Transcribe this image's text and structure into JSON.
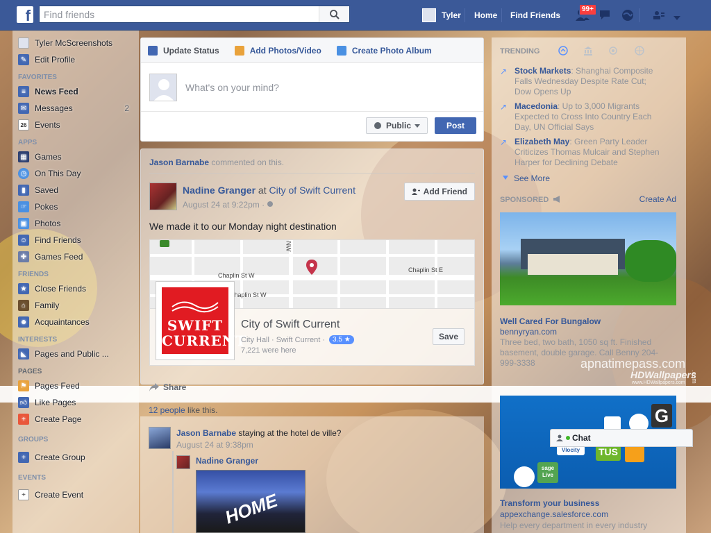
{
  "topbar": {
    "logo": "f",
    "search_placeholder": "Find friends",
    "user_name": "Tyler",
    "home": "Home",
    "find_friends": "Find Friends",
    "friend_requests_badge": "99+"
  },
  "left": {
    "profile_name": "Tyler McScreenshots",
    "edit_profile": "Edit Profile",
    "favorites_head": "Favorites",
    "news_feed": "News Feed",
    "messages": "Messages",
    "messages_count": "2",
    "events": "Events",
    "events_icon": "26",
    "apps_head": "Apps",
    "apps": [
      "Games",
      "On This Day",
      "Saved",
      "Pokes",
      "Photos",
      "Find Friends",
      "Games Feed"
    ],
    "friends_head": "Friends",
    "friends": [
      "Close Friends",
      "Family",
      "Acquaintances"
    ],
    "interests_head": "Interests",
    "interests": [
      "Pages and Public ..."
    ],
    "pages_head": "Pages",
    "pages": [
      "Pages Feed",
      "Like Pages",
      "Create Page"
    ],
    "groups_head": "Groups",
    "create_group": "Create Group",
    "events_head": "Events",
    "create_event": "Create Event"
  },
  "composer": {
    "tab_status": "Update Status",
    "tab_photos": "Add Photos/Video",
    "tab_album": "Create Photo Album",
    "placeholder": "What's on your mind?",
    "privacy": "Public",
    "post": "Post"
  },
  "story": {
    "context_actor": "Jason Barnabe",
    "context_text": "commented on this.",
    "author": "Nadine Granger",
    "at": "at",
    "place": "City of Swift Current",
    "time": "August 24 at 9:22pm · ",
    "add_friend": "Add Friend",
    "text": "We made it to our Monday night destination",
    "map_labels": [
      "Chaplin St W",
      "Chaplin St W",
      "Chaplin St E",
      "NW"
    ],
    "place_logo_line1": "SWIFT",
    "place_logo_line2": "CURRENT",
    "place_name": "City of Swift Current",
    "place_meta": "City Hall · Swift Current · ",
    "place_rating": "3.5 ★",
    "place_visits": "7,221 were here",
    "save": "Save",
    "share": "Share",
    "likes_people": "12 people",
    "likes_text": " like this."
  },
  "comments": {
    "c1_name": "Jason Barnabe",
    "c1_text": " staying at the hotel de ville?",
    "c1_time": "August 24 at 9:38pm",
    "c2_name": "Nadine Granger",
    "photo_text": "HOME"
  },
  "right": {
    "trending_head": "Trending",
    "trends": [
      {
        "topic": "Stock Markets",
        "text": ": Shanghai Composite Falls Wednesday Despite Rate Cut; Dow Opens Up"
      },
      {
        "topic": "Macedonia",
        "text": ": Up to 3,000 Migrants Expected to Cross Into Country Each Day, UN Official Says"
      },
      {
        "topic": "Elizabeth May",
        "text": ": Green Party Leader Criticizes Thomas Mulcair and Stephen Harper for Declining Debate"
      }
    ],
    "see_more": "See More",
    "sponsored_head": "Sponsored",
    "create_ad": "Create Ad",
    "ad1_title": "Well Cared For Bungalow",
    "ad1_url": "bennyryan.com",
    "ad1_desc": "Three bed, two bath, 1050 sq ft. Finished basement, double garage. Call Benny 204-999-3338",
    "ad2_title": "Transform your business",
    "ad2_url": "appexchange.salesforce.com",
    "ad2_desc": "Help every department in every industry",
    "ad2_tiles": [
      "G",
      "TUS",
      "sage Live",
      "Vlocity"
    ]
  },
  "chat": {
    "label": "Chat"
  },
  "watermark": {
    "site1": "apnatimepass.com",
    "site2": "HDWallpapers",
    "site3": "www.HDWallpapers.com",
    "site4": ".com"
  },
  "colors": {
    "brand": "#3b5998",
    "link": "#365899",
    "badge": "#fa3e3e",
    "post_button": "#4267b2",
    "place_logo": "#e11b22"
  }
}
